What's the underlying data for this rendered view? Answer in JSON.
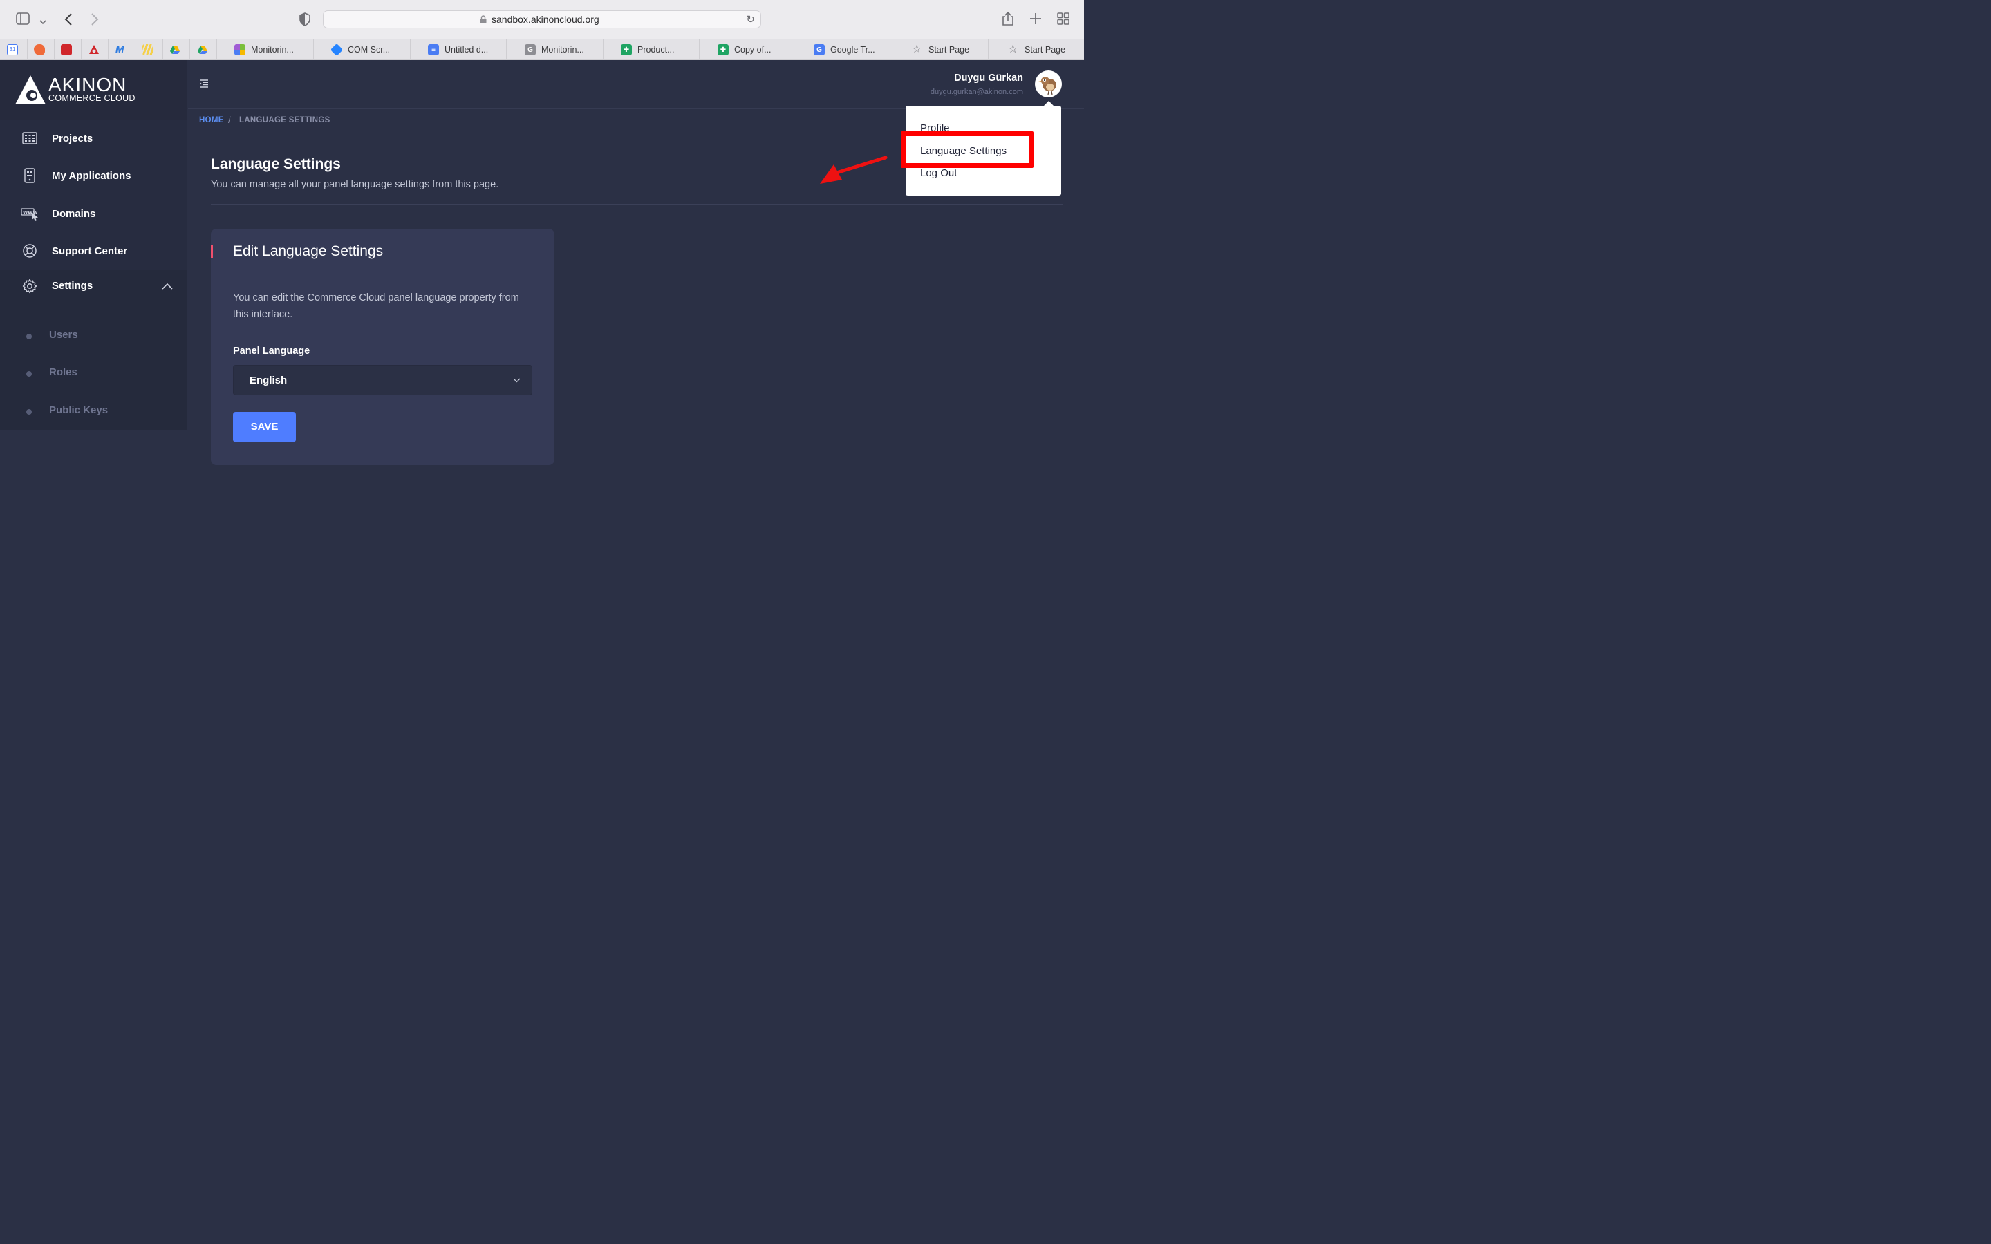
{
  "browser": {
    "url": "sandbox.akinoncloud.org",
    "bookmarks": [
      {
        "label": "Monitorin...",
        "color": "#7bbf3a"
      },
      {
        "label": "COM Scr...",
        "color": "#2684ff"
      },
      {
        "label": "Untitled d...",
        "color": "#4a7cf3"
      },
      {
        "label": "Monitorin...",
        "color": "#8d8d93"
      },
      {
        "label": "Product...",
        "color": "#1fa463"
      },
      {
        "label": "Copy of...",
        "color": "#1fa463"
      },
      {
        "label": "Google Tr...",
        "color": "#4a7cf3"
      },
      {
        "label": "Start Page",
        "color": "star"
      },
      {
        "label": "Start Page",
        "color": "star"
      }
    ]
  },
  "brand": {
    "name": "AKINON",
    "tagline": "COMMERCE CLOUD"
  },
  "sidebar": {
    "items": [
      {
        "label": "Projects",
        "icon": "grid-icon"
      },
      {
        "label": "My Applications",
        "icon": "app-icon"
      },
      {
        "label": "Domains",
        "icon": "www-icon"
      },
      {
        "label": "Support Center",
        "icon": "lifebuoy-icon"
      },
      {
        "label": "Settings",
        "icon": "gear-icon"
      }
    ],
    "sub_items": [
      {
        "label": "Users"
      },
      {
        "label": "Roles"
      },
      {
        "label": "Public Keys"
      }
    ]
  },
  "user": {
    "name": "Duygu Gürkan",
    "email": "duygu.gurkan@akinon.com"
  },
  "breadcrumb": {
    "home": "HOME",
    "separator": "/",
    "current": "LANGUAGE SETTINGS"
  },
  "page": {
    "title": "Language Settings",
    "subtitle": "You can manage all your panel language settings from this page."
  },
  "card": {
    "title": "Edit Language Settings",
    "description": "You can edit the Commerce Cloud panel language property from this interface.",
    "field_label": "Panel Language",
    "selected_language": "English",
    "save_label": "SAVE"
  },
  "user_menu": {
    "items": [
      {
        "label": "Profile"
      },
      {
        "label": "Language Settings"
      },
      {
        "label": "Log Out"
      }
    ]
  },
  "colors": {
    "accent": "#4f7dff",
    "annotation": "#ff0000",
    "card_marker": "#f0506e"
  }
}
